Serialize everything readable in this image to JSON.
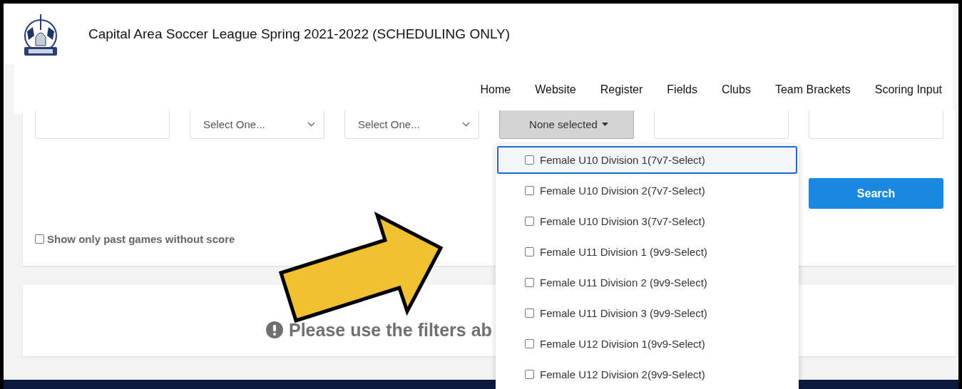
{
  "header": {
    "title": "Capital Area Soccer League Spring 2021-2022 (SCHEDULING ONLY)"
  },
  "nav": [
    {
      "label": "Home"
    },
    {
      "label": "Website"
    },
    {
      "label": "Register"
    },
    {
      "label": "Fields"
    },
    {
      "label": "Clubs"
    },
    {
      "label": "Team Brackets"
    },
    {
      "label": "Scoring Input"
    }
  ],
  "filters": [
    {
      "kind": "text"
    },
    {
      "kind": "select",
      "value": "Select One..."
    },
    {
      "kind": "select",
      "value": "Select One..."
    },
    {
      "kind": "multiselect",
      "value": "None selected"
    },
    {
      "kind": "text"
    },
    {
      "kind": "text"
    }
  ],
  "search_button": "Search",
  "past_games_checkbox": {
    "label": "Show only past games without score",
    "checked": false
  },
  "message": "Please use the filters ab",
  "dropdown_options": [
    {
      "label": "Female U10 Division 1(7v7-Select)",
      "checked": false,
      "selected": true
    },
    {
      "label": "Female U10 Division 2(7v7-Select)",
      "checked": false,
      "selected": false
    },
    {
      "label": "Female U10 Division 3(7v7-Select)",
      "checked": false,
      "selected": false
    },
    {
      "label": "Female U11 Division 1 (9v9-Select)",
      "checked": false,
      "selected": false
    },
    {
      "label": "Female U11 Division 2 (9v9-Select)",
      "checked": false,
      "selected": false
    },
    {
      "label": "Female U11 Division 3 (9v9-Select)",
      "checked": false,
      "selected": false
    },
    {
      "label": "Female U12 Division 1(9v9-Select)",
      "checked": false,
      "selected": false
    },
    {
      "label": "Female U12 Division 2(9v9-Select)",
      "checked": false,
      "selected": false
    }
  ]
}
